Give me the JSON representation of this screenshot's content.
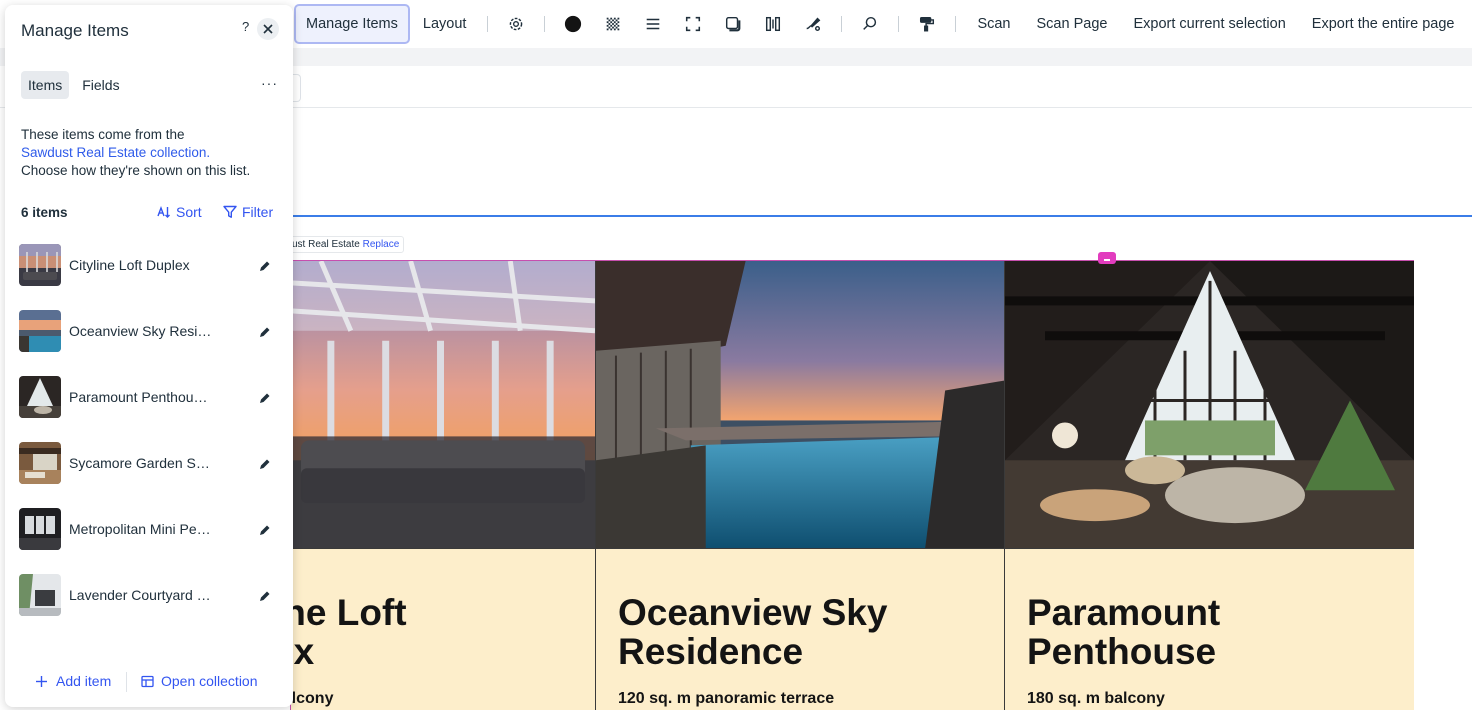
{
  "toolbar": {
    "manage_items": "Manage Items",
    "layout": "Layout",
    "icons": [
      "gear-icon",
      "fill-color-icon",
      "pattern-icon",
      "list-icon",
      "corners-icon",
      "shadow-icon",
      "spacing-icon",
      "design-icon",
      "search-icon",
      "paint-roller-icon"
    ],
    "scan": "Scan",
    "scan_page": "Scan Page",
    "export_selection": "Export current selection",
    "export_page": "Export the entire page"
  },
  "canvas": {
    "collection_label_prefix": "ust Real Estate",
    "collection_label_link": "Replace",
    "cards": [
      {
        "title": "ine Loft\nex",
        "subtitle": "balcony"
      },
      {
        "title": "Oceanview Sky\nResidence",
        "subtitle": "120 sq. m panoramic terrace"
      },
      {
        "title": "Paramount\nPenthouse",
        "subtitle": "180 sq. m balcony"
      }
    ]
  },
  "panel": {
    "title": "Manage Items",
    "help": "?",
    "tabs": [
      "Items",
      "Fields"
    ],
    "more": "···",
    "description_pre": "These items come from the",
    "description_link": "Sawdust Real Estate collection.",
    "description_post": "Choose how they're shown on this list.",
    "count": "6 items",
    "sort": "Sort",
    "filter": "Filter",
    "items": [
      {
        "name": "Cityline Loft Duplex"
      },
      {
        "name": "Oceanview Sky Resi…"
      },
      {
        "name": "Paramount  Penthou…"
      },
      {
        "name": "Sycamore Garden S…"
      },
      {
        "name": "Metropolitan Mini Pe…"
      },
      {
        "name": "Lavender Courtyard …"
      }
    ],
    "add_item": "Add item",
    "open_collection": "Open collection"
  },
  "colors": {
    "accent": "#3355f0",
    "card_background": "#fdeecb",
    "selection_pink": "#c64fae",
    "selection_blue": "#3b7de8"
  }
}
